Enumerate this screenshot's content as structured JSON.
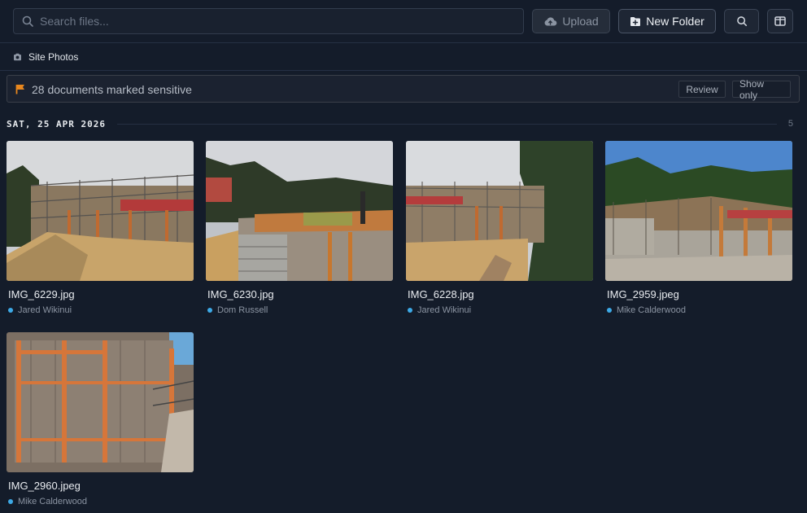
{
  "toolbar": {
    "search_placeholder": "Search files...",
    "upload_label": "Upload",
    "new_folder_label": "New Folder"
  },
  "breadcrumb": {
    "folder": "Site Photos"
  },
  "banner": {
    "text": "28 documents marked sensitive",
    "review_label": "Review",
    "show_only_label": "Show only"
  },
  "group": {
    "date_label": "SAT, 25 APR 2026",
    "count": "5"
  },
  "files": [
    {
      "name": "IMG_6229.jpg",
      "owner": "Jared Wikinui"
    },
    {
      "name": "IMG_6230.jpg",
      "owner": "Dom Russell"
    },
    {
      "name": "IMG_6228.jpg",
      "owner": "Jared Wikinui"
    },
    {
      "name": "IMG_2959.jpeg",
      "owner": "Mike Calderwood"
    },
    {
      "name": "IMG_2960.jpeg",
      "owner": "Mike Calderwood"
    }
  ],
  "colors": {
    "background": "#141c2a",
    "owner_dot": "#3da9e6",
    "flag": "#e8871e"
  }
}
